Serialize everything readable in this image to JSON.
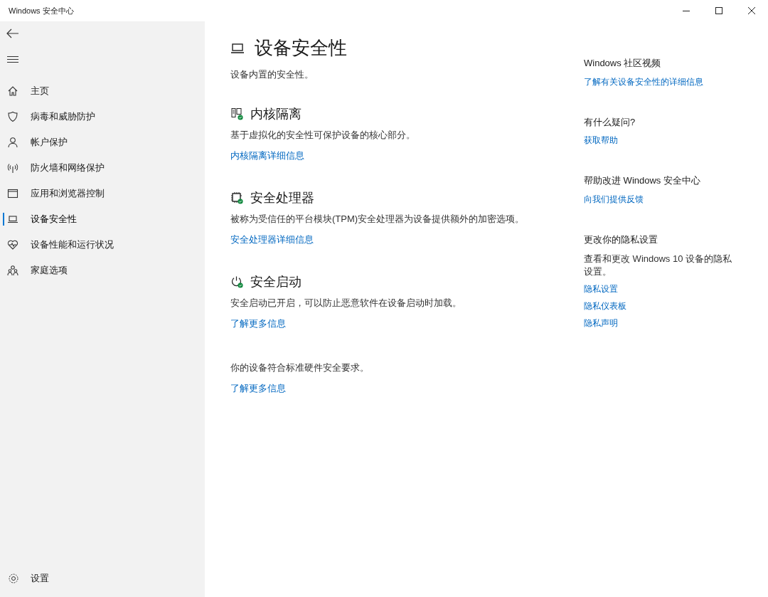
{
  "window": {
    "title": "Windows 安全中心"
  },
  "sidebar": {
    "items": [
      {
        "kind": "home",
        "label": "主页",
        "selected": false
      },
      {
        "kind": "shield",
        "label": "病毒和威胁防护",
        "selected": false
      },
      {
        "kind": "person",
        "label": "帐户保护",
        "selected": false
      },
      {
        "kind": "antenna",
        "label": "防火墙和网络保护",
        "selected": false
      },
      {
        "kind": "browser",
        "label": "应用和浏览器控制",
        "selected": false
      },
      {
        "kind": "laptop",
        "label": "设备安全性",
        "selected": true
      },
      {
        "kind": "heart",
        "label": "设备性能和运行状况",
        "selected": false
      },
      {
        "kind": "family",
        "label": "家庭选项",
        "selected": false
      }
    ],
    "settings": {
      "label": "设置"
    }
  },
  "page": {
    "title": "设备安全性",
    "subtitle": "设备内置的安全性。",
    "sections": [
      {
        "kind": "core",
        "title": "内核隔离",
        "text": "基于虚拟化的安全性可保护设备的核心部分。",
        "link": "内核隔离详细信息"
      },
      {
        "kind": "chip",
        "title": "安全处理器",
        "text": "被称为受信任的平台模块(TPM)安全处理器为设备提供额外的加密选项。",
        "link": "安全处理器详细信息"
      },
      {
        "kind": "boot",
        "title": "安全启动",
        "text": "安全启动已开启，可以防止恶意软件在设备启动时加载。",
        "link": "了解更多信息"
      }
    ],
    "footer": {
      "text": "你的设备符合标准硬件安全要求。",
      "link": "了解更多信息"
    }
  },
  "aside": [
    {
      "heading": "Windows 社区视频",
      "links": [
        "了解有关设备安全性的详细信息"
      ]
    },
    {
      "heading": "有什么疑问?",
      "links": [
        "获取帮助"
      ]
    },
    {
      "heading": "帮助改进 Windows 安全中心",
      "links": [
        "向我们提供反馈"
      ]
    },
    {
      "heading": "更改你的隐私设置",
      "text": "查看和更改 Windows 10 设备的隐私设置。",
      "links": [
        "隐私设置",
        "隐私仪表板",
        "隐私声明"
      ]
    }
  ]
}
